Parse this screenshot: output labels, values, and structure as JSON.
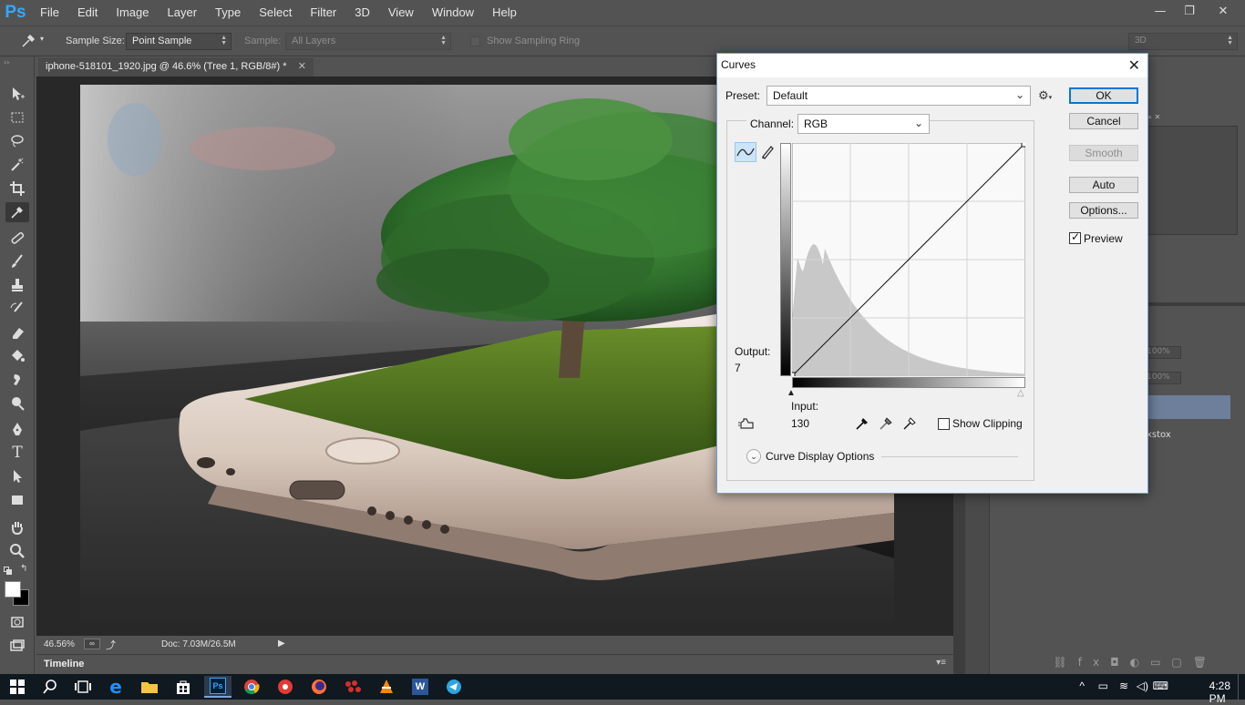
{
  "app": {
    "logo": "Ps"
  },
  "menu": [
    "File",
    "Edit",
    "Image",
    "Layer",
    "Type",
    "Select",
    "Filter",
    "3D",
    "View",
    "Window",
    "Help"
  ],
  "window_controls": {
    "minimize": "—",
    "restore": "❐",
    "close": "✕"
  },
  "options_bar": {
    "sample_size_label": "Sample Size:",
    "sample_size_value": "Point Sample",
    "sample_label": "Sample:",
    "sample_value": "All Layers",
    "sampling_ring_label": "Show Sampling Ring",
    "workspace_value": "3D"
  },
  "document": {
    "tab_title": "iphone-518101_1920.jpg @ 46.6% (Tree 1, RGB/8#) *",
    "zoom": "46.56%",
    "doc_size": "Doc: 7.03M/26.5M",
    "timeline_label": "Timeline"
  },
  "right_panel": {
    "opacity_1": "100%",
    "opacity_2": "100%",
    "layer_label_partial": "xstox"
  },
  "curves": {
    "title": "Curves",
    "preset_label": "Preset:",
    "preset_value": "Default",
    "channel_label": "Channel:",
    "channel_value": "RGB",
    "output_label": "Output:",
    "output_value": "7",
    "input_label": "Input:",
    "input_value": "130",
    "show_clipping_label": "Show Clipping",
    "show_clipping_checked": false,
    "display_options_label": "Curve Display Options",
    "buttons": {
      "ok": "OK",
      "cancel": "Cancel",
      "smooth": "Smooth",
      "auto": "Auto",
      "options": "Options..."
    },
    "preview_label": "Preview",
    "preview_checked": true,
    "grid_color": "#d4d4d4",
    "histogram_color": "#c8c8c8"
  },
  "taskbar": {
    "apps": [
      "start-icon",
      "search-icon",
      "task-view-icon",
      "edge-icon",
      "file-explorer-icon",
      "store-icon",
      "photoshop-icon",
      "chrome-icon",
      "app-red-icon",
      "firefox-icon",
      "app-dots-icon",
      "vlc-icon",
      "word-icon",
      "telegram-icon"
    ],
    "clock": "4:28 PM"
  },
  "colors": {
    "accent": "#31a8ff",
    "ui_bg": "#535353",
    "canvas_bg": "#282828",
    "dialog_bg": "#f0f0f0"
  }
}
